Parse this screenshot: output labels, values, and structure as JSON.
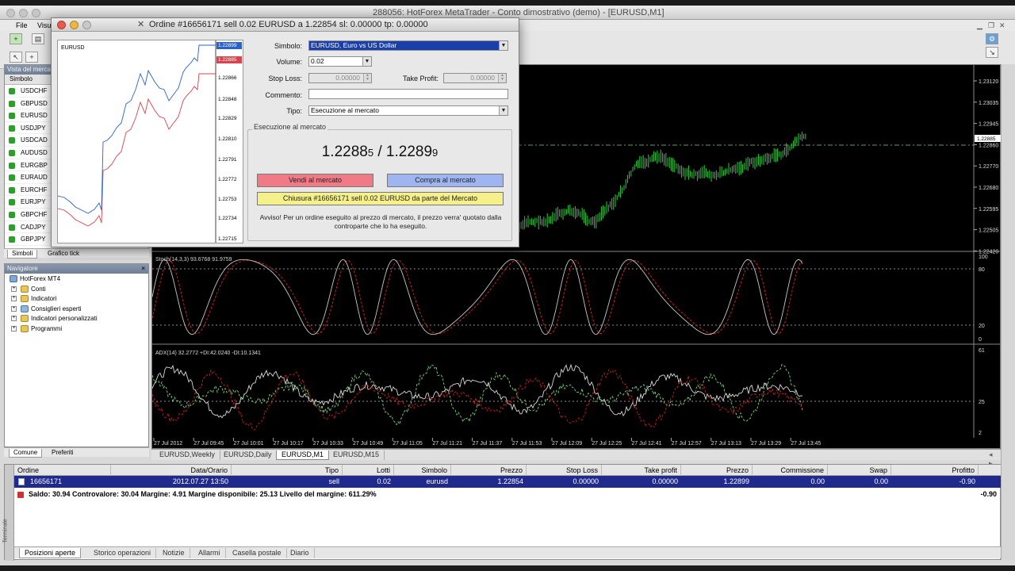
{
  "window": {
    "title": "288056: HotForex MetaTrader - Conto dimostrativo (demo) - [EURUSD,M1]"
  },
  "menu": {
    "file": "File",
    "view": "Visu"
  },
  "market_watch": {
    "title": "Vista del merca",
    "col_symbol": "Simbolo",
    "symbols": [
      {
        "name": "USDCHF",
        "dir": "up"
      },
      {
        "name": "GBPUSD",
        "dir": "up"
      },
      {
        "name": "EURUSD",
        "dir": "up"
      },
      {
        "name": "USDJPY",
        "dir": "up"
      },
      {
        "name": "USDCAD",
        "dir": "up"
      },
      {
        "name": "AUDUSD",
        "dir": "up"
      },
      {
        "name": "EURGBP",
        "dir": "up"
      },
      {
        "name": "EURAUD",
        "dir": "up"
      },
      {
        "name": "EURCHF",
        "dir": "up"
      },
      {
        "name": "EURJPY",
        "dir": "up"
      },
      {
        "name": "GBPCHF",
        "dir": "up"
      },
      {
        "name": "CADJPY",
        "dir": "up"
      },
      {
        "name": "GBPJPY",
        "dir": "up"
      }
    ],
    "tabs": [
      "Simboli",
      "Grafico tick"
    ]
  },
  "navigator": {
    "title": "Navigatore",
    "root": "HotForex MT4",
    "items": [
      "Conti",
      "Indicatori",
      "Consiglieri esperti",
      "Indicatori personalizzati",
      "Programmi"
    ],
    "tabs": [
      "Comune",
      "Preferiti"
    ]
  },
  "chart": {
    "symbol_tab_active": "EURUSD,M1",
    "tabs": [
      "EURUSD,Weekly",
      "EURUSD,Daily",
      "EURUSD,M1",
      "EURUSD,M15"
    ],
    "price_scale": [
      "1.23120",
      "1.23035",
      "1.22945",
      "1.22860",
      "1.22770",
      "1.22680",
      "1.22595",
      "1.22505",
      "1.22420"
    ],
    "current_price_label": "1.22885",
    "stoch_label": "Stoch(14,3,3) 93.6768 91.9759",
    "stoch_scale": [
      "100",
      "80",
      "20",
      "0"
    ],
    "adx_label": "ADX(14) 32.2772 +DI:42.0240 -DI:10.1341",
    "adx_scale": [
      "61",
      "25",
      "2"
    ],
    "time_labels": [
      "27 Jul 2012",
      "27 Jul 09:45",
      "27 Jul 10:01",
      "27 Jul 10:17",
      "27 Jul 10:33",
      "27 Jul 10:49",
      "27 Jul 11:05",
      "27 Jul 11:21",
      "27 Jul 11:37",
      "27 Jul 11:53",
      "27 Jul 12:09",
      "27 Jul 12:25",
      "27 Jul 12:41",
      "27 Jul 12:57",
      "27 Jul 13:13",
      "27 Jul 13:29",
      "27 Jul 13:45"
    ]
  },
  "dialog": {
    "title": "Ordine #16656171 sell 0.02 EURUSD a 1.22854 sl: 0.00000 tp: 0.00000",
    "mini_symbol": "EURUSD",
    "mini_scale": [
      "1.22899",
      "1.22885",
      "1.22866",
      "1.22848",
      "1.22829",
      "1.22810",
      "1.22791",
      "1.22772",
      "1.22753",
      "1.22734",
      "1.22715"
    ],
    "labels": {
      "symbol": "Simbolo:",
      "volume": "Volume:",
      "stop_loss": "Stop Loss:",
      "take_profit": "Take Profit:",
      "comment": "Commento:",
      "type": "Tipo:"
    },
    "values": {
      "symbol": "EURUSD, Euro vs US Dollar",
      "volume": "0.02",
      "stop_loss": "0.00000",
      "take_profit": "0.00000",
      "comment": "",
      "type": "Esecuzione al mercato"
    },
    "group_label": "Esecuzione al mercato",
    "price_bid_main": "1.2288",
    "price_bid_small": "5",
    "price_sep": " / ",
    "price_ask_main": "1.2289",
    "price_ask_small": "9",
    "sell_button": "Vendi al mercato",
    "buy_button": "Compra al mercato",
    "close_button": "Chiusura #16656171 sell 0.02 EURUSD da parte del Mercato",
    "warning": "Avviso! Per un ordine eseguito al prezzo di mercato, il prezzo verra' quotato dalla controparte che lo ha eseguito.",
    "colors": {
      "sell": "#f07a85",
      "buy": "#9fb5f2",
      "close": "#f5f08a"
    }
  },
  "terminal": {
    "side_label": "Terminale",
    "columns": [
      "Ordine",
      "Data/Orario",
      "Tipo",
      "Lotti",
      "Simbolo",
      "Prezzo",
      "Stop Loss",
      "Take profit",
      "Prezzo",
      "Commissione",
      "Swap",
      "Profitto"
    ],
    "row": [
      "16656171",
      "2012.07.27 13:50",
      "sell",
      "0.02",
      "eurusd",
      "1.22854",
      "0.00000",
      "0.00000",
      "1.22899",
      "0.00",
      "0.00",
      "-0.90"
    ],
    "balance": "Saldo: 30.94  Controvalore: 30.04  Margine: 4.91  Margine disponibile: 25.13  Livello del margine: 611.29%",
    "balance_profit": "-0.90",
    "tabs": [
      "Posizioni aperte",
      "Storico operazioni",
      "Notizie",
      "Allarmi",
      "Casella postale",
      "Diario"
    ]
  }
}
